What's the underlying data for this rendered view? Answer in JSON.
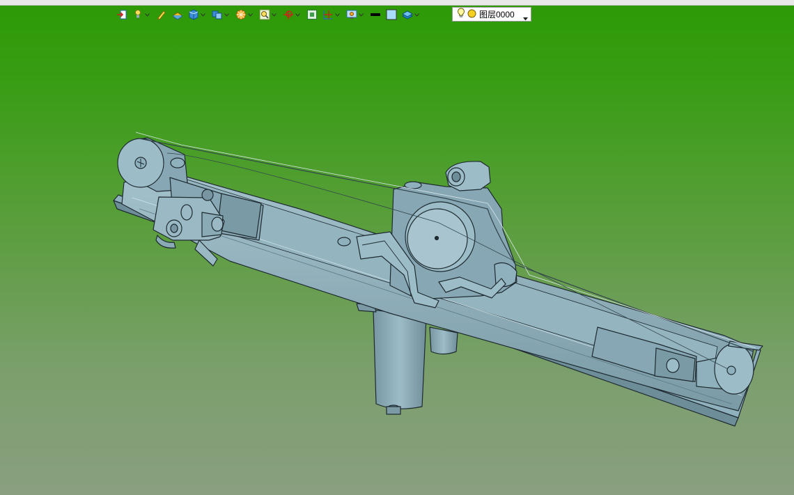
{
  "toolbar": {
    "tools": [
      {
        "name": "exit-sketch-icon",
        "dropdown": false
      },
      {
        "name": "light-icon",
        "dropdown": true
      },
      {
        "name": "pen-icon",
        "dropdown": false
      },
      {
        "name": "render-mode-icon",
        "dropdown": false
      },
      {
        "name": "shaded-cube-icon",
        "dropdown": true
      },
      {
        "name": "view-orientation-icon",
        "dropdown": true
      },
      {
        "name": "color-wheel-icon",
        "dropdown": true
      },
      {
        "name": "zoom-fit-icon",
        "dropdown": true
      },
      {
        "name": "rotate-axis-icon",
        "dropdown": true
      },
      {
        "name": "frame-select-icon",
        "dropdown": false
      },
      {
        "name": "section-view-icon",
        "dropdown": true
      },
      {
        "name": "display-settings-icon",
        "dropdown": true
      },
      {
        "name": "line-style-icon",
        "dropdown": false
      },
      {
        "name": "fill-color-icon",
        "dropdown": false
      },
      {
        "name": "layer-manager-icon",
        "dropdown": true
      }
    ],
    "layer": {
      "name": "图层0000",
      "bulb_icon": "lightbulb-icon",
      "status_icon": "layer-on-icon"
    }
  },
  "viewport": {
    "model": "window-regulator-assembly",
    "colors": {
      "background_top": "#2c9a05",
      "background_bottom": "#8a9f80",
      "part_fill": "#8fb1bd",
      "part_dark": "#6d8d98",
      "part_light": "#a8c5cf",
      "edge": "#1e2a30"
    }
  }
}
